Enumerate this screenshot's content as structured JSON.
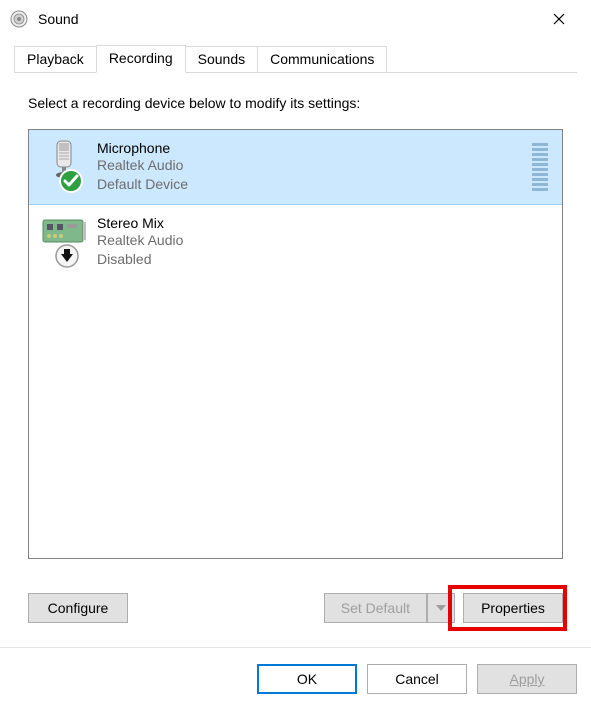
{
  "window": {
    "title": "Sound"
  },
  "tabs": {
    "playback": "Playback",
    "recording": "Recording",
    "sounds": "Sounds",
    "communications": "Communications"
  },
  "instruction": "Select a recording device below to modify its settings:",
  "devices": [
    {
      "name": "Microphone",
      "driver": "Realtek Audio",
      "status": "Default Device"
    },
    {
      "name": "Stereo Mix",
      "driver": "Realtek Audio",
      "status": "Disabled"
    }
  ],
  "buttons": {
    "configure": "Configure",
    "set_default": "Set Default",
    "properties": "Properties",
    "ok": "OK",
    "cancel": "Cancel",
    "apply": "Apply"
  }
}
